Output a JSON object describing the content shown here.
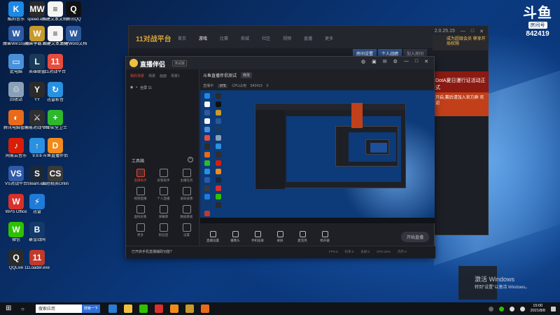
{
  "desktop": {
    "icons": [
      {
        "label": "酷狗音乐",
        "color": "#1e88e5",
        "glyph": "K"
      },
      {
        "label": "speed.exe",
        "color": "#2b2b2b",
        "glyph": "MW"
      },
      {
        "label": "新建文本文档 (2)",
        "color": "#f5f5f5",
        "glyph": "≡"
      },
      {
        "label": "腾讯QQ",
        "color": "#111111",
        "glyph": "Q"
      },
      {
        "label": "魔兽Win10启动",
        "color": "#2d5aa0",
        "glyph": "W"
      },
      {
        "label": "魔兽争霸.exe",
        "color": "#c79a2c",
        "glyph": "W"
      },
      {
        "label": "新建文本文档",
        "color": "#f5f5f5",
        "glyph": "≡"
      },
      {
        "label": "新建Word文档.doc",
        "color": "#2b579a",
        "glyph": "W"
      },
      {
        "label": "此电脑",
        "color": "#4a90d9",
        "glyph": "▭"
      },
      {
        "label": "英雄联盟",
        "color": "#1b3a5a",
        "glyph": "L"
      },
      {
        "label": "11对战平台",
        "color": "#e84c3d",
        "glyph": "11"
      },
      {
        "label": "回收站",
        "color": "#8aa0b8",
        "glyph": "♲"
      },
      {
        "label": "YY",
        "color": "#2b2b2b",
        "glyph": "Y"
      },
      {
        "label": "迅雷影音",
        "color": "#2a90e0",
        "glyph": "↻"
      },
      {
        "label": "腾讯电脑管家",
        "color": "#e86a1a",
        "glyph": "◐"
      },
      {
        "label": "网易对战平台",
        "color": "#2f2f2f",
        "glyph": "⚔"
      },
      {
        "label": "360安全卫士",
        "color": "#2eb82e",
        "glyph": "+"
      },
      {
        "label": "网易云音乐",
        "color": "#d81e06",
        "glyph": "♪"
      },
      {
        "label": "9.9.6",
        "color": "#2a90e0",
        "glyph": "↑"
      },
      {
        "label": "斗鱼直播伴侣",
        "color": "#f08a1c",
        "glyph": "D"
      },
      {
        "label": "VS对战平台",
        "color": "#2f5aa8",
        "glyph": "VS"
      },
      {
        "label": "Steam.exe",
        "color": "#1b2838",
        "glyph": "S"
      },
      {
        "label": "反恐精英Online",
        "color": "#3a3a3a",
        "glyph": "CS"
      },
      {
        "label": "WPS Office",
        "color": "#d9302c",
        "glyph": "W"
      },
      {
        "label": "迅雷",
        "color": "#1f7bd8",
        "glyph": "⚡"
      },
      {
        "label": "微信",
        "color": "#2dc100",
        "glyph": "W"
      },
      {
        "label": "暴雪战网",
        "color": "#123a6a",
        "glyph": "B"
      },
      {
        "label": "QQLive",
        "color": "#2b2b2b",
        "glyph": "Q"
      },
      {
        "label": "11Loader.exe",
        "color": "#c0392b",
        "glyph": "11"
      }
    ],
    "watermark": {
      "brand": "斗鱼",
      "sub": "房间号",
      "room_number": "842419"
    },
    "activate_line1": "激活 Windows",
    "activate_line2": "转到\"设置\"以激活 Windows。"
  },
  "back_window": {
    "logo": "11对战平台",
    "nav": [
      "首页",
      "游戏",
      "比赛",
      "商城",
      "社区",
      "视频",
      "直播",
      "更多"
    ],
    "active_nav": "游戏",
    "version": "2.0.25.15",
    "tabs": [
      "房间设置",
      "个人战绩",
      "加入房间"
    ],
    "promo_top": "成为超级会员 尊享开局权限",
    "promo_red": "DotA夏日漫行证活动正式",
    "promo_orange": "开启,赛后请加入官方群 欢迎"
  },
  "main_window": {
    "app_name": "直播伴侣",
    "version_badge": "测试版",
    "title_tools": [
      "skin",
      "gift",
      "message",
      "settings",
      "min",
      "max",
      "close"
    ],
    "left_tabs": [
      "我的场景",
      "场景",
      "画面",
      "场景1"
    ],
    "active_left_tab": "我的场景",
    "scene_item": "全屏 11",
    "tool_box_title": "工具箱",
    "tools": [
      {
        "label": "直播助手",
        "highlight": true
      },
      {
        "label": "房管助手",
        "highlight": false
      },
      {
        "label": "主播任务",
        "highlight": false
      },
      {
        "label": "视频直播",
        "highlight": false
      },
      {
        "label": "个人直播",
        "highlight": false
      },
      {
        "label": "录屏录像",
        "highlight": false
      },
      {
        "label": "虚拟形象",
        "highlight": false
      },
      {
        "label": "弹幕库",
        "highlight": false
      },
      {
        "label": "数据看板",
        "highlight": false
      },
      {
        "label": "更多",
        "highlight": false
      },
      {
        "label": "粉丝团",
        "highlight": false
      },
      {
        "label": "设置",
        "highlight": false
      }
    ],
    "stream_title": "斗鱼直播伴侣测试",
    "edit_label": "修改",
    "status_items": [
      "直播中",
      "975",
      "CPU占用",
      "842419",
      "0"
    ],
    "controls": [
      "直播设置",
      "摄像头",
      "手机投屏",
      "录屏",
      "麦克风",
      "扬声器"
    ],
    "start_button": "开始直播",
    "footer_tip": "已开启手机直播辅助功能?",
    "footer_stats": [
      "FPS:0",
      "码率:0",
      "丢帧:0",
      "CPU:22%",
      "内存:0"
    ]
  },
  "taskbar": {
    "search_placeholder": "搜索应用",
    "search_button": "搜索一下",
    "time": "15:00",
    "date": "2021/8/8",
    "apps": [
      "#2b7cd3",
      "#f0c040",
      "#2dc100",
      "#d9302c",
      "#f08a1c",
      "#c79a2c",
      "#e86a1a"
    ]
  }
}
